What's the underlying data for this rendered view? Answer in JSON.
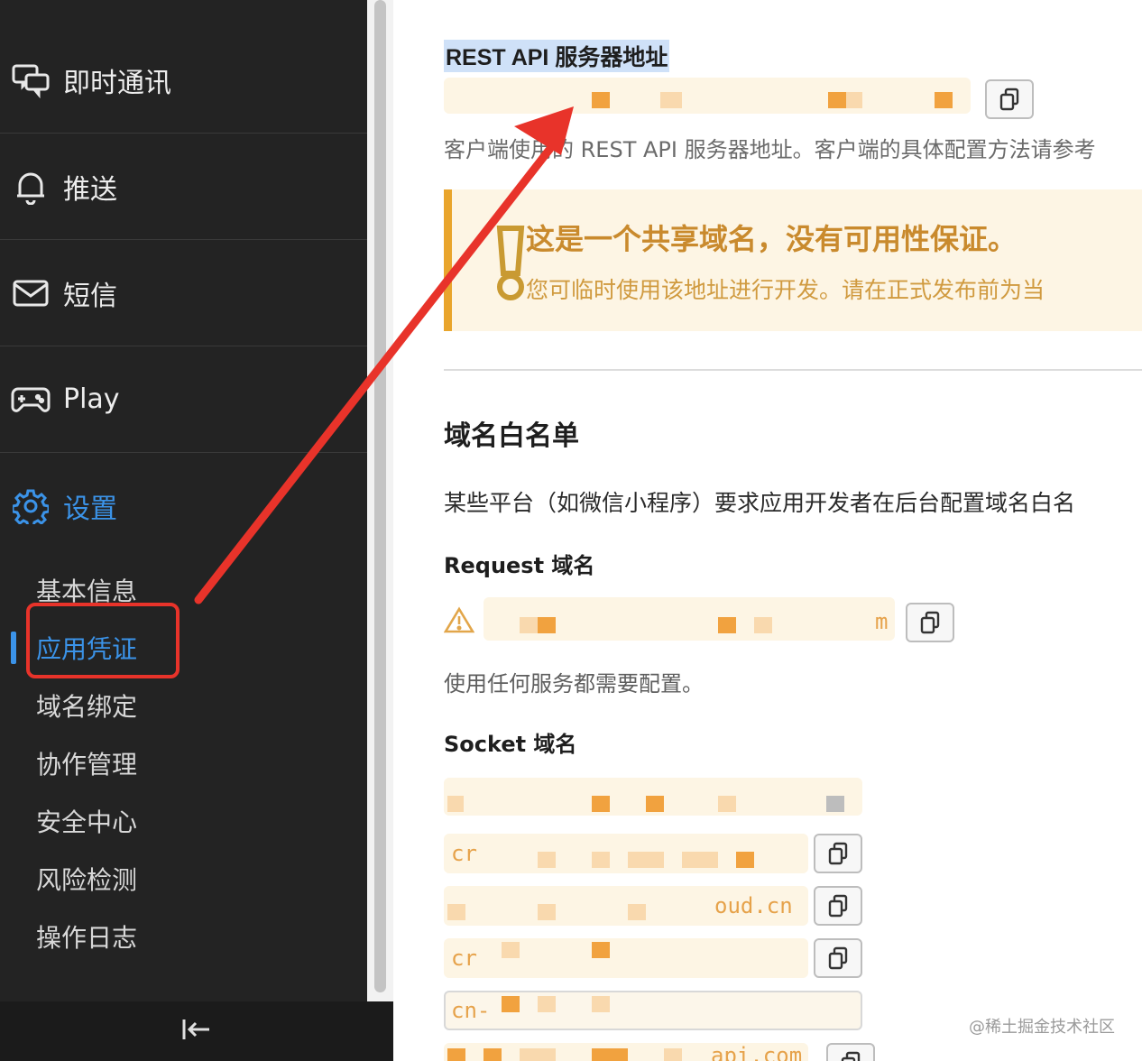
{
  "sidebar": {
    "nav": [
      {
        "label": "即时通讯",
        "icon": "chat-icon"
      },
      {
        "label": "推送",
        "icon": "bell-icon"
      },
      {
        "label": "短信",
        "icon": "mail-icon"
      },
      {
        "label": "Play",
        "icon": "gamepad-icon"
      },
      {
        "label": "设置",
        "icon": "gear-icon",
        "active": true
      }
    ],
    "sub_items": [
      "基本信息",
      "应用凭证",
      "域名绑定",
      "协作管理",
      "安全中心",
      "风险检测",
      "操作日志"
    ],
    "active_sub_item": "应用凭证",
    "collapse_icon": "collapse-left-icon"
  },
  "main": {
    "rest_api_title": "REST API 服务器地址",
    "rest_api_desc": "客户端使用的 REST API 服务器地址。客户端的具体配置方法请参考",
    "warning": {
      "title": "这是一个共享域名，没有可用性保证。",
      "text": "您可临时使用该地址进行开发。请在正式发布前为当"
    },
    "domain_whitelist": {
      "heading": "域名白名单",
      "description": "某些平台（如微信小程序）要求应用开发者在后台配置域名白名",
      "request_label": "Request 域名",
      "request_visible_fragment": "m",
      "request_note": "使用任何服务都需要配置。",
      "socket_label": "Socket 域名",
      "socket_fragments": [
        "cr",
        "oud.cn",
        "cr",
        "cn-",
        "api.com"
      ]
    }
  },
  "watermark": "@稀土掘金技术社区",
  "colors": {
    "sidebar_bg": "#232323",
    "accent": "#3b93e8",
    "warning_accent": "#e9a52c",
    "annotation_red": "#e8332a"
  }
}
